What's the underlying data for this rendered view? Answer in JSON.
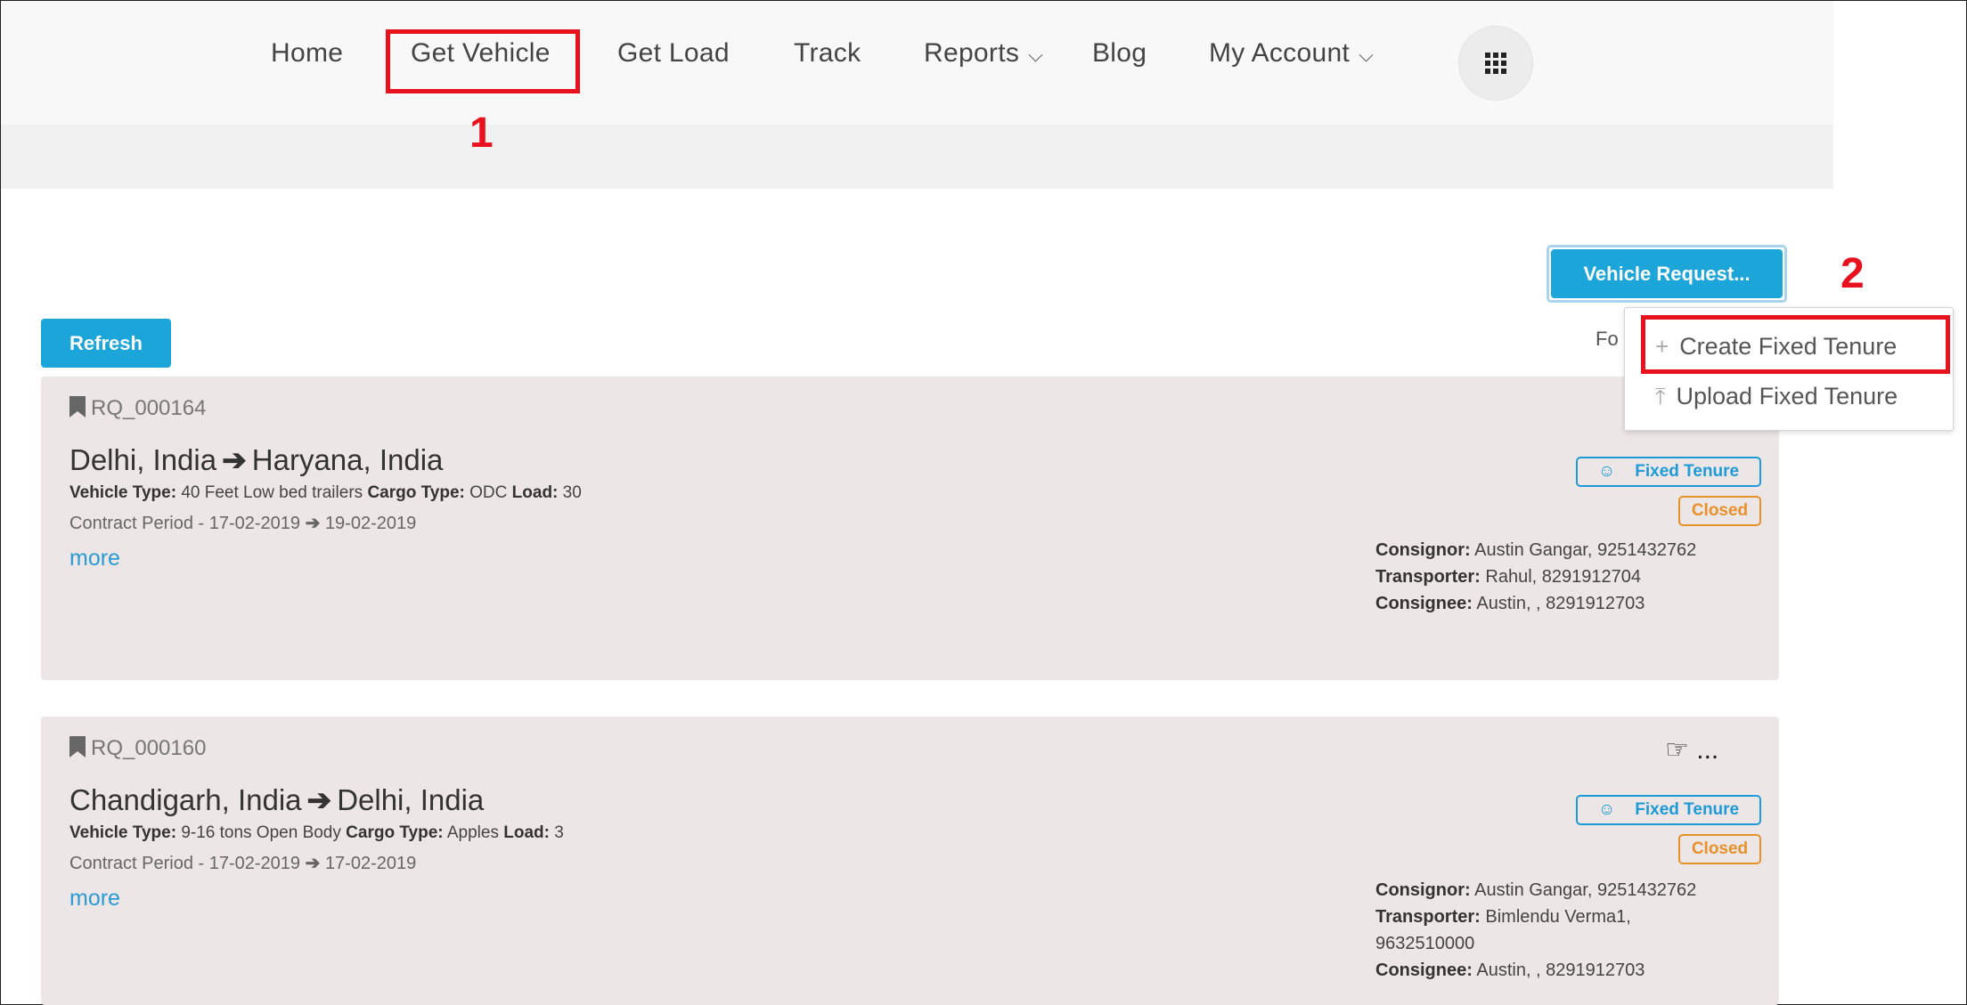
{
  "nav": {
    "items": [
      {
        "label": "Home"
      },
      {
        "label": "Get Vehicle"
      },
      {
        "label": "Get Load"
      },
      {
        "label": "Track"
      },
      {
        "label": "Reports"
      },
      {
        "label": "Blog"
      },
      {
        "label": "My Account"
      }
    ]
  },
  "annotations": {
    "step1": "1",
    "step2": "2",
    "highlight_color": "#e8121e"
  },
  "toolbar": {
    "refresh_label": "Refresh",
    "vehicle_request_label": "Vehicle Request...",
    "found_text": "Fo"
  },
  "dropdown": {
    "create_label": "Create Fixed Tenure",
    "upload_label": "Upload Fixed Tenure"
  },
  "cards": [
    {
      "id": "RQ_000164",
      "from": "Delhi, India",
      "to": "Haryana, India",
      "vehicle_type_label": "Vehicle Type:",
      "vehicle_type": "40 Feet Low bed trailers",
      "cargo_type_label": "Cargo Type:",
      "cargo_type": "ODC",
      "load_label": "Load:",
      "load": "30",
      "contract_label": "Contract Period -",
      "contract_from": "17-02-2019",
      "contract_to": "19-02-2019",
      "more": "more",
      "tenure_badge": "Fixed Tenure",
      "status_badge": "Closed",
      "consignor_label": "Consignor:",
      "consignor": "Austin Gangar, 9251432762",
      "transporter_label": "Transporter:",
      "transporter": "Rahul, 8291912704",
      "consignee_label": "Consignee:",
      "consignee": "Austin, , 8291912703"
    },
    {
      "id": "RQ_000160",
      "from": "Chandigarh, India",
      "to": "Delhi, India",
      "vehicle_type_label": "Vehicle Type:",
      "vehicle_type": "9-16 tons Open Body",
      "cargo_type_label": "Cargo Type:",
      "cargo_type": "Apples",
      "load_label": "Load:",
      "load": "3",
      "contract_label": "Contract Period -",
      "contract_from": "17-02-2019",
      "contract_to": "17-02-2019",
      "more": "more",
      "action_ellipsis": "...",
      "tenure_badge": "Fixed Tenure",
      "status_badge": "Closed",
      "consignor_label": "Consignor:",
      "consignor": "Austin Gangar, 9251432762",
      "transporter_label": "Transporter:",
      "transporter_line1": "Bimlendu Verma1,",
      "transporter_line2": "9632510000",
      "consignee_label": "Consignee:",
      "consignee": "Austin, , 8291912703"
    }
  ],
  "colors": {
    "primary": "#1ca5d9",
    "card_bg": "#ede6e6",
    "tenure": "#1e9ad6",
    "closed": "#e8902a",
    "link": "#2a9bd4"
  }
}
